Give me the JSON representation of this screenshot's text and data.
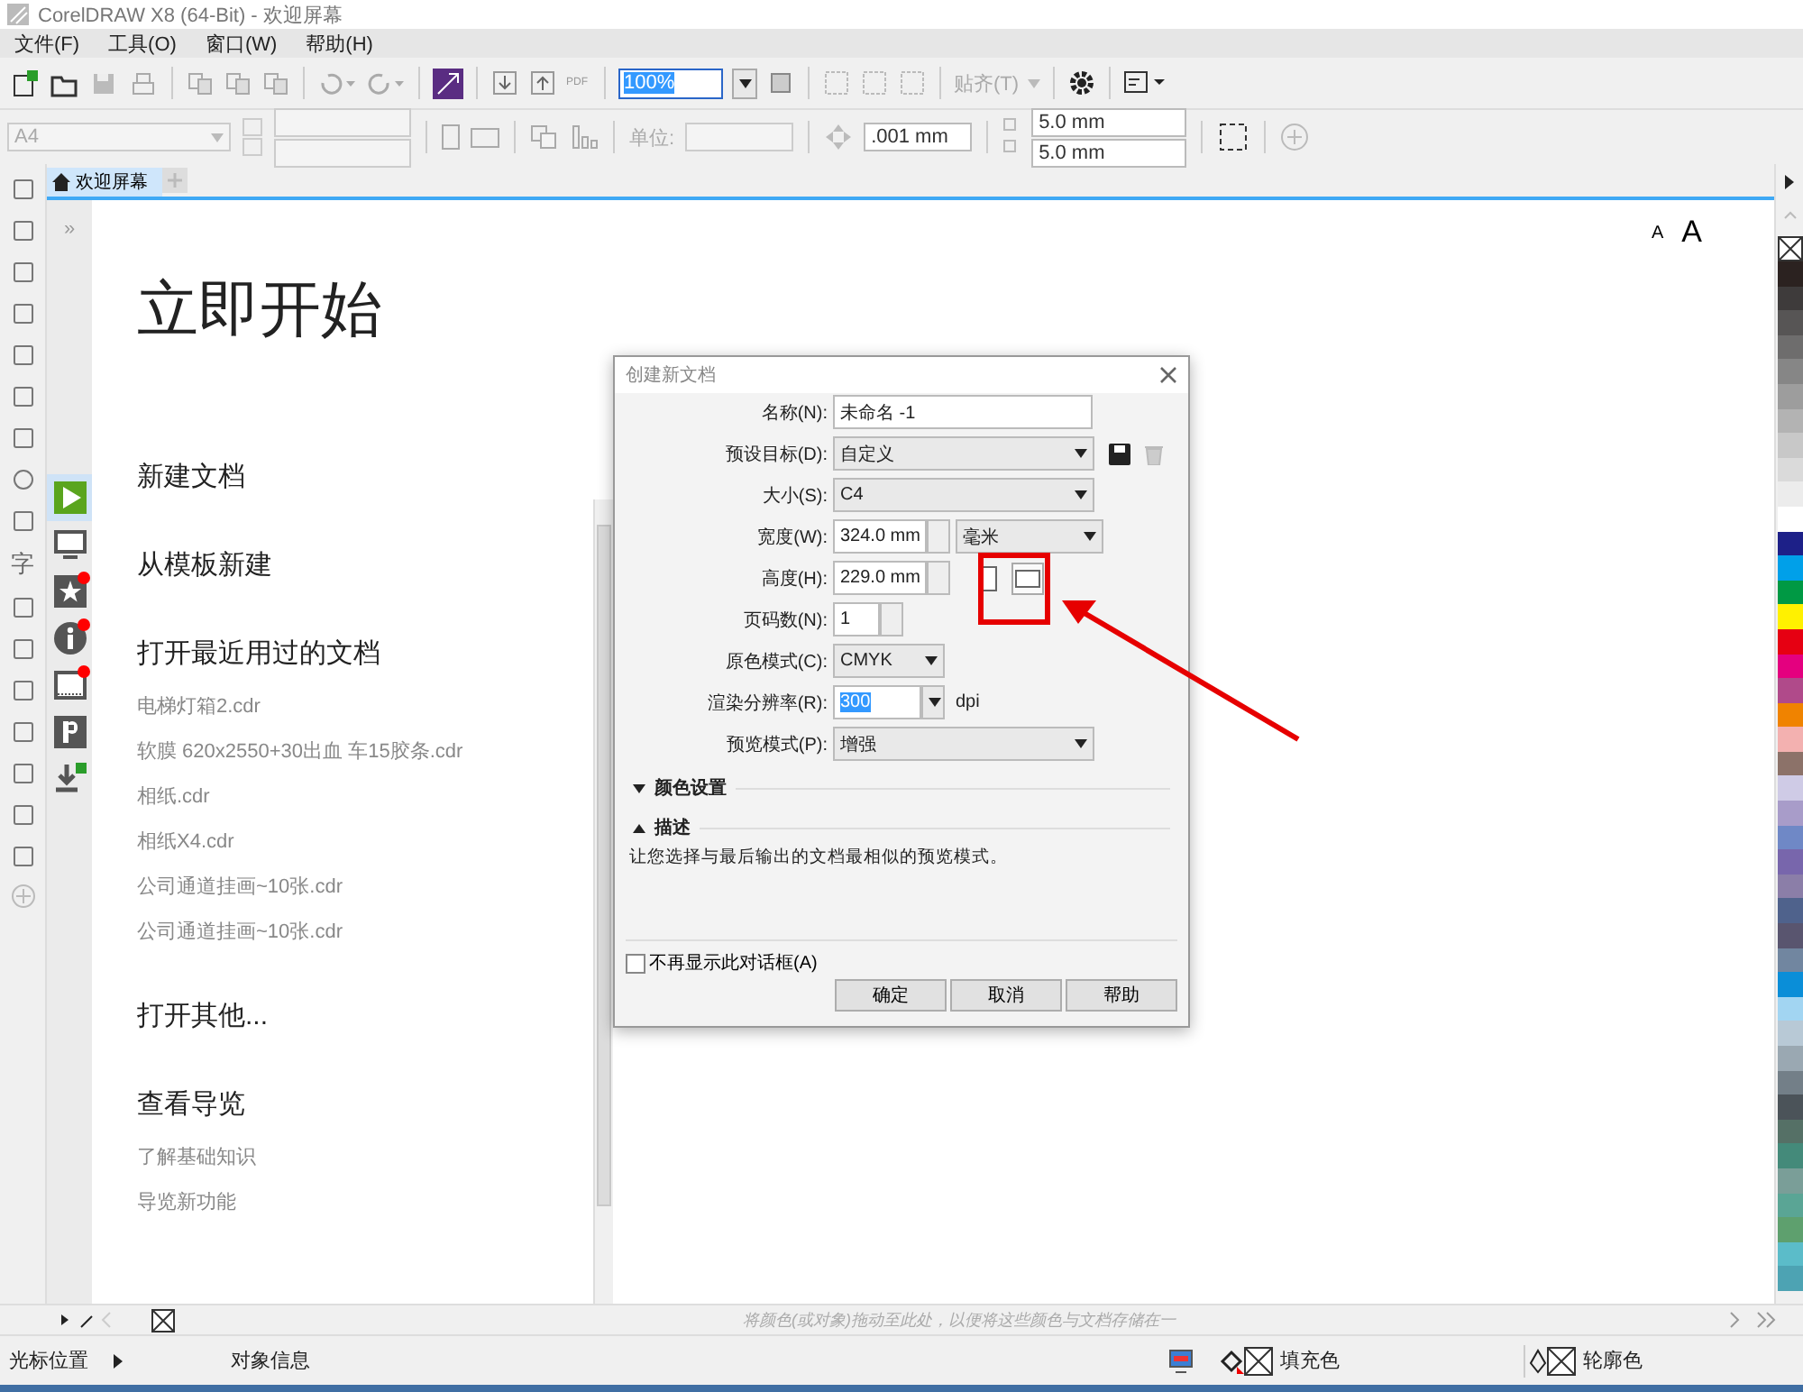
{
  "window": {
    "title": "CorelDRAW X8 (64-Bit) - 欢迎屏幕"
  },
  "menu": [
    "文件(F)",
    "工具(O)",
    "窗口(W)",
    "帮助(H)"
  ],
  "toolbar": {
    "pdf_label": "PDF",
    "zoom": "100%",
    "snap": "贴齐(T)"
  },
  "property_bar": {
    "page_size": "A4",
    "units_label": "单位:",
    "nudge": ".001 mm",
    "dup_x": "5.0 mm",
    "dup_y": "5.0 mm"
  },
  "toolbox": {
    "text_tool_glyph": "字"
  },
  "tabs": [
    {
      "label": "欢迎屏幕",
      "selected": true
    }
  ],
  "docker_expand": "»",
  "docker": [
    {
      "selected": true,
      "badge": false
    },
    {
      "selected": false,
      "badge": false
    },
    {
      "selected": false,
      "badge": true
    },
    {
      "selected": false,
      "badge": true
    },
    {
      "selected": false,
      "badge": true
    },
    {
      "selected": false,
      "badge": false
    },
    {
      "selected": false,
      "badge": false
    }
  ],
  "welcome": {
    "heading": "立即开始",
    "font_buttons": [
      "A",
      "A"
    ],
    "sections": [
      {
        "title": "新建文档"
      },
      {
        "title": "从模板新建"
      },
      {
        "title": "打开最近用过的文档",
        "items": [
          "电梯灯箱2.cdr",
          "软膜 620x2550+30出血 车15胶条.cdr",
          "相纸.cdr",
          "相纸X4.cdr",
          "公司通道挂画~10张.cdr",
          "公司通道挂画~10张.cdr"
        ]
      },
      {
        "title": "打开其他..."
      },
      {
        "title": "查看导览",
        "items": [
          "了解基础知识",
          "导览新功能"
        ]
      }
    ]
  },
  "dialog": {
    "title": "创建新文档",
    "fields": [
      {
        "label": "名称(N):",
        "kind": "text",
        "value": "未命名 -1"
      },
      {
        "label": "预设目标(D):",
        "kind": "preset_select",
        "value": "自定义"
      },
      {
        "label": "大小(S):",
        "kind": "select",
        "value": "C4"
      },
      {
        "label": "宽度(W):",
        "kind": "spin_unit",
        "value": "324.0 mm",
        "unit": "毫米"
      },
      {
        "label": "高度(H):",
        "kind": "spin_orient",
        "value": "229.0 mm",
        "orientation": [
          {
            "selected": false
          },
          {
            "selected": true
          }
        ]
      },
      {
        "label": "页码数(N):",
        "kind": "count",
        "value": "1"
      },
      {
        "label": "原色模式(C):",
        "kind": "short_select",
        "value": "CMYK"
      },
      {
        "label": "渲染分辨率(R):",
        "kind": "combo",
        "value": "300",
        "suffix": "dpi"
      },
      {
        "label": "预览模式(P):",
        "kind": "select",
        "value": "增强"
      }
    ],
    "sections": [
      {
        "label": "颜色设置",
        "expanded": false
      },
      {
        "label": "描述",
        "expanded": true,
        "text": "让您选择与最后输出的文档最相似的预览模式。"
      }
    ],
    "checkbox": {
      "label": "不再显示此对话框(A)",
      "checked": false
    },
    "buttons": [
      "确定",
      "取消",
      "帮助"
    ]
  },
  "palette": {
    "hint": "将颜色(或对象)拖动至此处，以便将这些颜色与文档存储在一",
    "colors": [
      {
        "color": "#2b2220"
      },
      {
        "color": "#3e3b3b"
      },
      {
        "color": "#575555"
      },
      {
        "color": "#6e6d6d"
      },
      {
        "color": "#868686"
      },
      {
        "color": "#9d9d9d"
      },
      {
        "color": "#b3b3b3"
      },
      {
        "color": "#c8c8c8"
      },
      {
        "color": "#dadada"
      },
      {
        "color": "#ececec"
      },
      {
        "color": "#ffffff"
      },
      {
        "color": "#1d2088"
      },
      {
        "color": "#00a0e9"
      },
      {
        "color": "#009944"
      },
      {
        "color": "#fff100"
      },
      {
        "color": "#e60012"
      },
      {
        "color": "#e4007f"
      },
      {
        "color": "#b04a8a"
      },
      {
        "color": "#f08300"
      },
      {
        "color": "#f3b1b0"
      },
      {
        "color": "#8c7269"
      },
      {
        "color": "#cfcbe6"
      },
      {
        "color": "#a89cc9"
      },
      {
        "color": "#6f88c6"
      },
      {
        "color": "#7866ac"
      },
      {
        "color": "#8b7ea8"
      },
      {
        "color": "#4f628c"
      },
      {
        "color": "#59556f"
      },
      {
        "color": "#7186a0"
      },
      {
        "color": "#0a8ed8"
      },
      {
        "color": "#a2d5f2"
      },
      {
        "color": "#b8c9d6"
      },
      {
        "color": "#9aa8b2"
      },
      {
        "color": "#737f88"
      },
      {
        "color": "#4b5359"
      },
      {
        "color": "#557066"
      },
      {
        "color": "#448a7a"
      },
      {
        "color": "#7a9e98"
      },
      {
        "color": "#5aa595"
      },
      {
        "color": "#5ea06e"
      },
      {
        "color": "#5bbcc9"
      },
      {
        "color": "#4da3b3"
      }
    ]
  },
  "status_bar": {
    "cursor": "光标位置",
    "object_info": "对象信息",
    "fill": "填充色",
    "outline": "轮廓色"
  }
}
